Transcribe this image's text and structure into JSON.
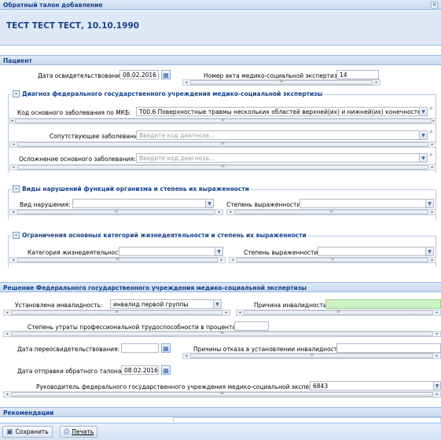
{
  "window": {
    "title": "Обратный талон добавление"
  },
  "patient_header": "ТЕСТ ТЕСТ ТЕСТ, 10.10.1990",
  "sections": {
    "patient": "Пациент",
    "decision": "Решение Федерального государственного учреждения медико-социальной экспертизы",
    "recommendations": "Рекомендации"
  },
  "patient": {
    "exam_date_label": "Дата освидетельствования:",
    "exam_date_value": "08.02.2016",
    "act_number_label": "Номер акта медико-социальной экспертизы:",
    "act_number_value": "14"
  },
  "diagnosis": {
    "legend": "Диагноз федерального государственного учреждения медико-социальной экспертизы",
    "main_code_label": "Код основного заболевания по МКБ:",
    "main_code_value": "T00.6 Поверхностные травмы нескольких областей верхней(их) и нижней(их) конечностей",
    "concomitant_label": "Сопутствующее заболевание:",
    "concomitant_placeholder": "Введите код диагноза...",
    "complication_label": "Осложнение основного заболевания:",
    "complication_placeholder": "Введите код диагноза..."
  },
  "impairments": {
    "legend": "Виды нарушений функций организма и степень их выраженности",
    "type_label": "Вид нарушения:",
    "degree_label": "Степень выраженности:"
  },
  "limitations": {
    "legend": "Ограничения основных категорий жизнедеятельности и степень их выраженности",
    "category_label": "Категория жизнедеятельности:",
    "degree_label": "Степень выраженности:"
  },
  "decision": {
    "disability_label": "Установлена инвалидность:",
    "disability_value": "инвалид первой группы",
    "cause_label": "Причина инвалидности:",
    "work_capacity_label": "Степень утраты профессиональной трудоспособности в процентах:",
    "reexam_date_label": "Дата переосвидетельствования:",
    "refusal_label": "Причины отказа в установлении инвалидности:",
    "send_date_label": "Дата отправки обратного талона:",
    "send_date_value": "08.02.2016",
    "head_label": "Руководитель федерального государственного учреждения медико-социальной экспертизы:",
    "head_value": "6843"
  },
  "toolbar": {
    "save": "Сохранить",
    "print": "Печать"
  },
  "icons": {
    "date": "calendar-icon",
    "search": "magnifier-icon",
    "dropdown": "chevron-down-icon",
    "close": "close-icon"
  }
}
